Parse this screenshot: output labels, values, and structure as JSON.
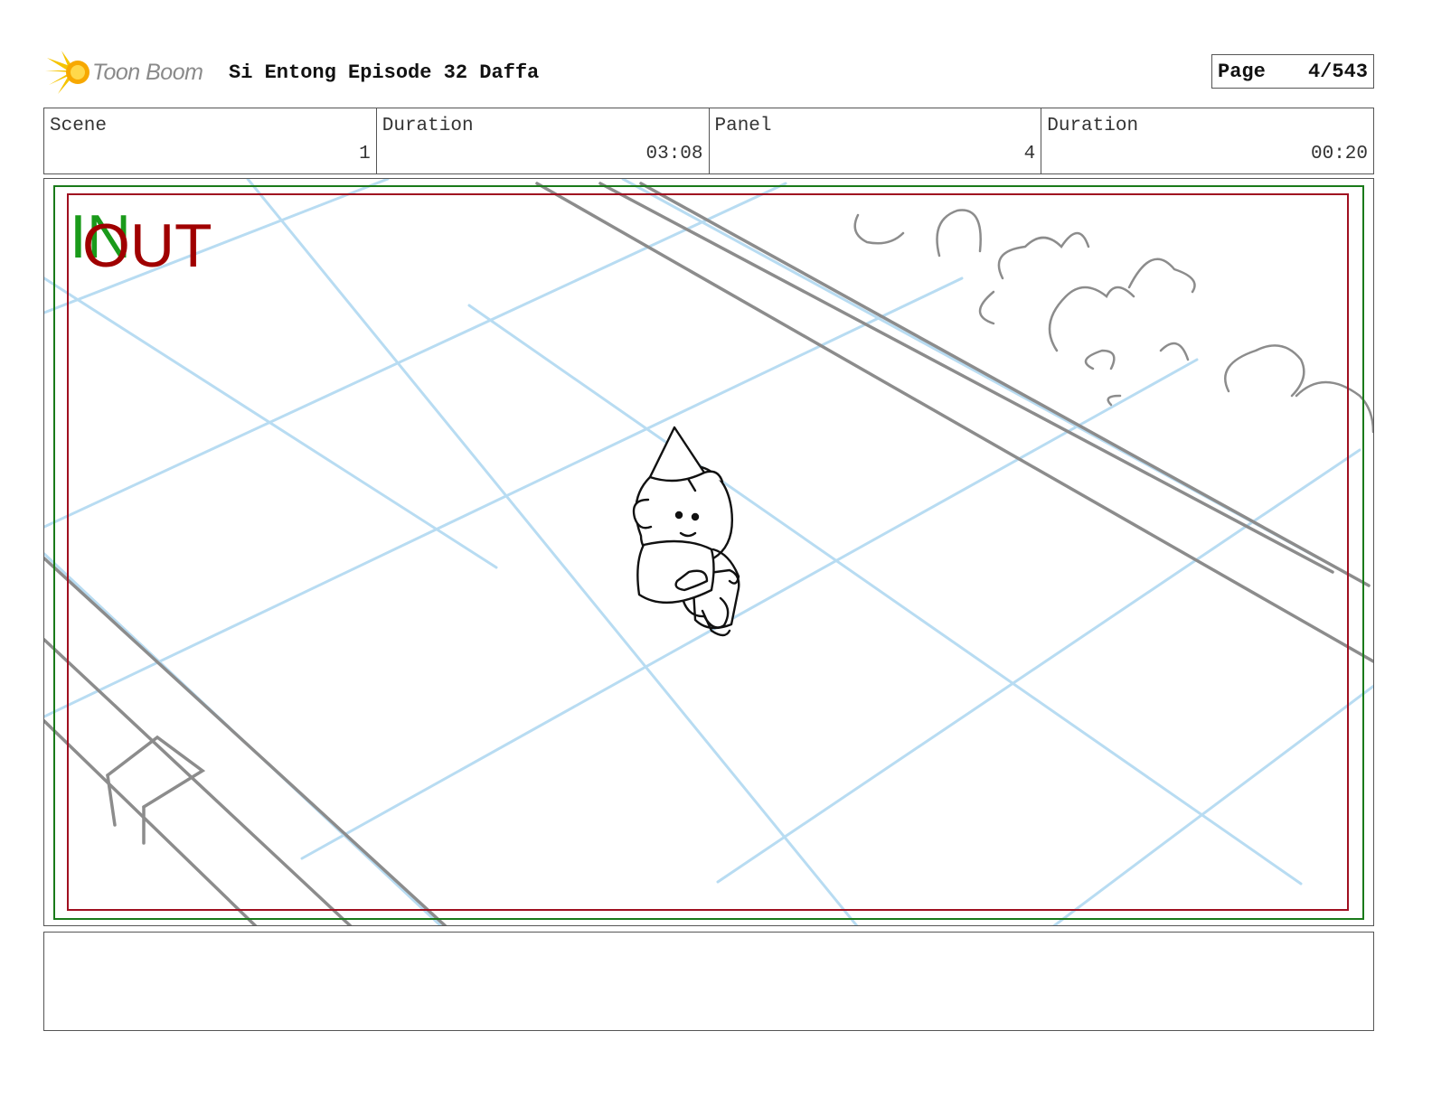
{
  "header": {
    "logo_text": "Toon Boom",
    "title": "Si Entong Episode 32 Daffa",
    "page_label": "Page",
    "page_value": "4/543"
  },
  "info": {
    "scene_label": "Scene",
    "scene_value": "1",
    "scene_duration_label": "Duration",
    "scene_duration_value": "03:08",
    "panel_label": "Panel",
    "panel_value": "4",
    "panel_duration_label": "Duration",
    "panel_duration_value": "00:20"
  },
  "panel": {
    "in_label": "IN",
    "out_label": "OUT"
  },
  "notes": {
    "text": ""
  },
  "colors": {
    "safe_frame_green": "#1a7a1a",
    "action_frame_red": "#a01020",
    "grid_blue": "#b8dcf2",
    "sketch_gray": "#8c8c8c",
    "ink_black": "#111111"
  }
}
